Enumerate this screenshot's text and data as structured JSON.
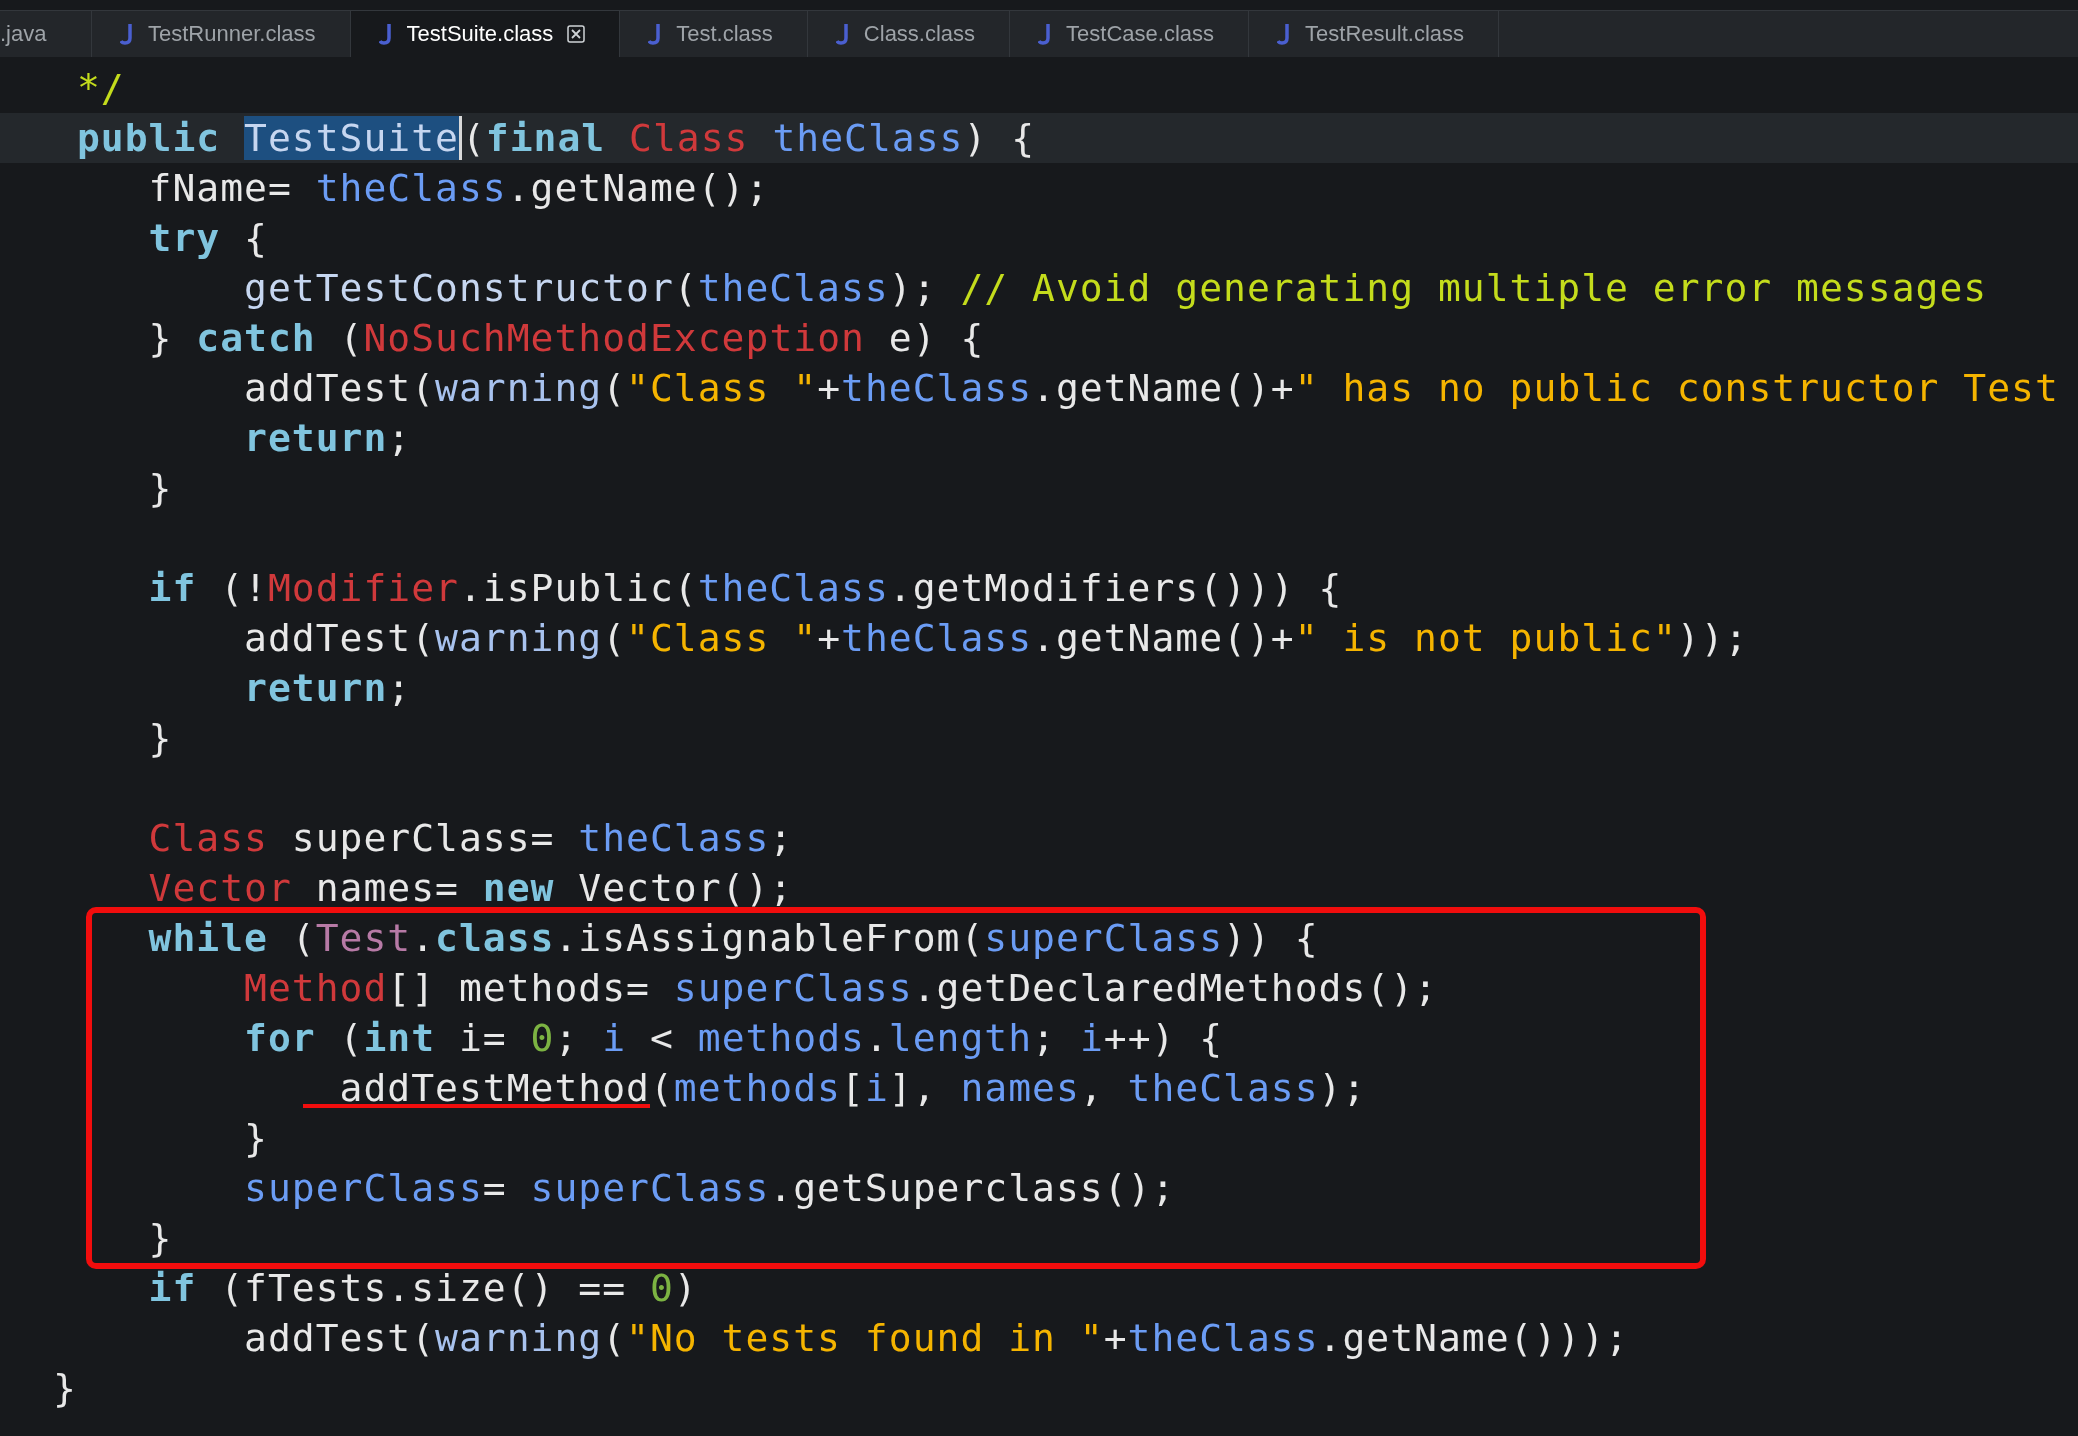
{
  "tabs": [
    {
      "label": ".java",
      "selected": false,
      "has_icon": false
    },
    {
      "label": "TestRunner.class",
      "selected": false,
      "has_icon": true
    },
    {
      "label": "TestSuite.class",
      "selected": true,
      "has_icon": true
    },
    {
      "label": "Test.class",
      "selected": false,
      "has_icon": true
    },
    {
      "label": "Class.class",
      "selected": false,
      "has_icon": true
    },
    {
      "label": "TestCase.class",
      "selected": false,
      "has_icon": true
    },
    {
      "label": "TestResult.class",
      "selected": false,
      "has_icon": true
    }
  ],
  "lines": [
    {
      "current": false,
      "boxed": false,
      "tokens": [
        {
          "kind": "comment",
          "text": " */"
        }
      ]
    },
    {
      "current": true,
      "boxed": false,
      "tokens": [
        {
          "kind": "keyword",
          "text": " public "
        },
        {
          "kind": "method",
          "text": "TestSuite",
          "selected": true
        },
        {
          "kind": "plain",
          "text": "("
        },
        {
          "kind": "keyword",
          "text": "final "
        },
        {
          "kind": "type",
          "text": "Class "
        },
        {
          "kind": "field",
          "text": "theClass"
        },
        {
          "kind": "plain",
          "text": ") {"
        }
      ]
    },
    {
      "current": false,
      "boxed": false,
      "tokens": [
        {
          "kind": "plain",
          "text": "    fName= "
        },
        {
          "kind": "field",
          "text": "theClass"
        },
        {
          "kind": "plain",
          "text": ".getName();"
        }
      ]
    },
    {
      "current": false,
      "boxed": false,
      "tokens": [
        {
          "kind": "keyword",
          "text": "    try "
        },
        {
          "kind": "plain",
          "text": "{"
        }
      ]
    },
    {
      "current": false,
      "boxed": false,
      "tokens": [
        {
          "kind": "method",
          "text": "        getTestConstructor"
        },
        {
          "kind": "plain",
          "text": "("
        },
        {
          "kind": "field",
          "text": "theClass"
        },
        {
          "kind": "plain",
          "text": "); "
        },
        {
          "kind": "comment",
          "text": "// Avoid generating multiple error messages"
        }
      ]
    },
    {
      "current": false,
      "boxed": false,
      "tokens": [
        {
          "kind": "plain",
          "text": "    } "
        },
        {
          "kind": "keyword",
          "text": "catch "
        },
        {
          "kind": "plain",
          "text": "("
        },
        {
          "kind": "type",
          "text": "NoSuchMethodException "
        },
        {
          "kind": "plain",
          "text": "e) {"
        }
      ]
    },
    {
      "current": false,
      "boxed": false,
      "tokens": [
        {
          "kind": "plain",
          "text": "        addTest("
        },
        {
          "kind": "call",
          "text": "warning"
        },
        {
          "kind": "plain",
          "text": "("
        },
        {
          "kind": "string",
          "text": "\"Class \""
        },
        {
          "kind": "plain",
          "text": "+"
        },
        {
          "kind": "field",
          "text": "theClass"
        },
        {
          "kind": "plain",
          "text": ".getName()+"
        },
        {
          "kind": "string",
          "text": "\" has no public constructor Test"
        }
      ]
    },
    {
      "current": false,
      "boxed": false,
      "tokens": [
        {
          "kind": "keyword",
          "text": "        return"
        },
        {
          "kind": "plain",
          "text": ";"
        }
      ]
    },
    {
      "current": false,
      "boxed": false,
      "tokens": [
        {
          "kind": "plain",
          "text": "    }"
        }
      ]
    },
    {
      "current": false,
      "boxed": false
    },
    {
      "current": false,
      "boxed": false,
      "tokens": [
        {
          "kind": "keyword",
          "text": "    if "
        },
        {
          "kind": "plain",
          "text": "(!"
        },
        {
          "kind": "type",
          "text": "Modifier"
        },
        {
          "kind": "plain",
          "text": ".isPublic("
        },
        {
          "kind": "field",
          "text": "theClass"
        },
        {
          "kind": "plain",
          "text": ".getModifiers())) {"
        }
      ]
    },
    {
      "current": false,
      "boxed": false,
      "tokens": [
        {
          "kind": "plain",
          "text": "        addTest("
        },
        {
          "kind": "call",
          "text": "warning"
        },
        {
          "kind": "plain",
          "text": "("
        },
        {
          "kind": "string",
          "text": "\"Class \""
        },
        {
          "kind": "plain",
          "text": "+"
        },
        {
          "kind": "field",
          "text": "theClass"
        },
        {
          "kind": "plain",
          "text": ".getName()+"
        },
        {
          "kind": "string",
          "text": "\" is not public\""
        },
        {
          "kind": "plain",
          "text": "));"
        }
      ]
    },
    {
      "current": false,
      "boxed": false,
      "tokens": [
        {
          "kind": "keyword",
          "text": "        return"
        },
        {
          "kind": "plain",
          "text": ";"
        }
      ]
    },
    {
      "current": false,
      "boxed": false,
      "tokens": [
        {
          "kind": "plain",
          "text": "    }"
        }
      ]
    },
    {
      "current": false,
      "boxed": false
    },
    {
      "current": false,
      "boxed": false,
      "tokens": [
        {
          "kind": "type",
          "text": "    Class "
        },
        {
          "kind": "plain",
          "text": "superClass= "
        },
        {
          "kind": "field",
          "text": "theClass"
        },
        {
          "kind": "plain",
          "text": ";"
        }
      ]
    },
    {
      "current": false,
      "boxed": false,
      "tokens": [
        {
          "kind": "type",
          "text": "    Vector "
        },
        {
          "kind": "plain",
          "text": "names= "
        },
        {
          "kind": "keyword",
          "text": "new "
        },
        {
          "kind": "plain",
          "text": "Vector();"
        }
      ]
    },
    {
      "current": false,
      "boxed": true,
      "tokens": [
        {
          "kind": "keyword",
          "text": "    while "
        },
        {
          "kind": "plain",
          "text": "("
        },
        {
          "kind": "interface",
          "text": "Test"
        },
        {
          "kind": "plain",
          "text": "."
        },
        {
          "kind": "keyword",
          "text": "class"
        },
        {
          "kind": "plain",
          "text": ".isAssignableFrom("
        },
        {
          "kind": "field",
          "text": "superClass"
        },
        {
          "kind": "plain",
          "text": ")) {"
        }
      ]
    },
    {
      "current": false,
      "boxed": true,
      "tokens": [
        {
          "kind": "type",
          "text": "        Method"
        },
        {
          "kind": "plain",
          "text": "[] methods= "
        },
        {
          "kind": "field",
          "text": "superClass"
        },
        {
          "kind": "plain",
          "text": ".getDeclaredMethods();"
        }
      ]
    },
    {
      "current": false,
      "boxed": true,
      "tokens": [
        {
          "kind": "keyword",
          "text": "        for "
        },
        {
          "kind": "plain",
          "text": "("
        },
        {
          "kind": "keyword",
          "text": "int "
        },
        {
          "kind": "plain",
          "text": "i= "
        },
        {
          "kind": "number",
          "text": "0"
        },
        {
          "kind": "plain",
          "text": "; "
        },
        {
          "kind": "field",
          "text": "i "
        },
        {
          "kind": "plain",
          "text": "< "
        },
        {
          "kind": "field",
          "text": "methods"
        },
        {
          "kind": "plain",
          "text": "."
        },
        {
          "kind": "field",
          "text": "length"
        },
        {
          "kind": "plain",
          "text": "; "
        },
        {
          "kind": "field",
          "text": "i"
        },
        {
          "kind": "plain",
          "text": "++) {"
        }
      ]
    },
    {
      "current": false,
      "boxed": true,
      "tokens": [
        {
          "kind": "plain",
          "text": "            addTestMethod",
          "underlined": true
        },
        {
          "kind": "plain",
          "text": "("
        },
        {
          "kind": "field",
          "text": "methods"
        },
        {
          "kind": "plain",
          "text": "["
        },
        {
          "kind": "field",
          "text": "i"
        },
        {
          "kind": "plain",
          "text": "], "
        },
        {
          "kind": "field",
          "text": "names"
        },
        {
          "kind": "plain",
          "text": ", "
        },
        {
          "kind": "field",
          "text": "theClass"
        },
        {
          "kind": "plain",
          "text": ");"
        }
      ]
    },
    {
      "current": false,
      "boxed": true,
      "tokens": [
        {
          "kind": "plain",
          "text": "        }"
        }
      ]
    },
    {
      "current": false,
      "boxed": true,
      "tokens": [
        {
          "kind": "field",
          "text": "        superClass"
        },
        {
          "kind": "plain",
          "text": "= "
        },
        {
          "kind": "field",
          "text": "superClass"
        },
        {
          "kind": "plain",
          "text": ".getSuperclass();"
        }
      ]
    },
    {
      "current": false,
      "boxed": true,
      "tokens": [
        {
          "kind": "plain",
          "text": "    }"
        }
      ]
    },
    {
      "current": false,
      "boxed": false,
      "tokens": [
        {
          "kind": "keyword",
          "text": "    if "
        },
        {
          "kind": "plain",
          "text": "(fTests.size() == "
        },
        {
          "kind": "number",
          "text": "0"
        },
        {
          "kind": "plain",
          "text": ")"
        }
      ]
    },
    {
      "current": false,
      "boxed": false,
      "tokens": [
        {
          "kind": "plain",
          "text": "        addTest("
        },
        {
          "kind": "call",
          "text": "warning"
        },
        {
          "kind": "plain",
          "text": "("
        },
        {
          "kind": "string",
          "text": "\"No tests found in \""
        },
        {
          "kind": "plain",
          "text": "+"
        },
        {
          "kind": "field",
          "text": "theClass"
        },
        {
          "kind": "plain",
          "text": ".getName()));"
        }
      ]
    },
    {
      "current": false,
      "boxed": false,
      "tokens": [
        {
          "kind": "plain",
          "text": "}"
        }
      ]
    }
  ]
}
